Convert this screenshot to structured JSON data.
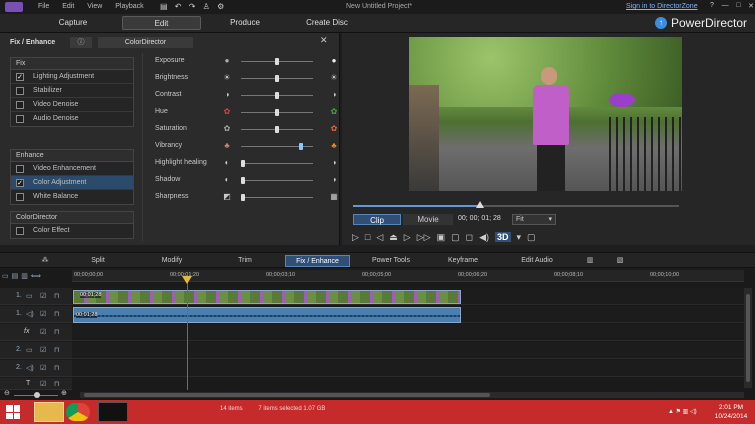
{
  "title_bar": {
    "menu": [
      "File",
      "Edit",
      "View",
      "Playback"
    ],
    "project_title": "New Untitled Project*",
    "signin_link": "Sign in to DirectorZone",
    "window_controls": [
      "?",
      "—",
      "□",
      "✕"
    ]
  },
  "modes": {
    "items": [
      "Capture",
      "Edit",
      "Produce",
      "Create Disc"
    ],
    "active": "Edit",
    "brand": "PowerDirector"
  },
  "fix_panel": {
    "title": "Fix / Enhance",
    "info_symbol": "ⓘ",
    "tab_label": "ColorDirector",
    "close_symbol": "✕",
    "groups": [
      {
        "header": "Fix",
        "items": [
          {
            "label": "Lighting Adjustment",
            "checked": true,
            "selected": false
          },
          {
            "label": "Stabilizer",
            "checked": false,
            "selected": false
          },
          {
            "label": "Video Denoise",
            "checked": false,
            "selected": false
          },
          {
            "label": "Audio Denoise",
            "checked": false,
            "selected": false
          }
        ]
      },
      {
        "header": "Enhance",
        "items": [
          {
            "label": "Video Enhancement",
            "checked": false,
            "selected": false
          },
          {
            "label": "Color Adjustment",
            "checked": true,
            "selected": true
          },
          {
            "label": "White Balance",
            "checked": false,
            "selected": false
          }
        ]
      },
      {
        "header": "ColorDirector",
        "items": [
          {
            "label": "Color Effect",
            "checked": false,
            "selected": false
          }
        ]
      }
    ],
    "sliders": [
      {
        "label": "Exposure",
        "value": 0.5
      },
      {
        "label": "Brightness",
        "value": 0.5
      },
      {
        "label": "Contrast",
        "value": 0.5
      },
      {
        "label": "Hue",
        "value": 0.5
      },
      {
        "label": "Saturation",
        "value": 0.5
      },
      {
        "label": "Vibrancy",
        "value": 0.85
      },
      {
        "label": "Highlight healing",
        "value": 0.0
      },
      {
        "label": "Shadow",
        "value": 0.0
      },
      {
        "label": "Sharpness",
        "value": 0.0
      }
    ]
  },
  "preview": {
    "progress": 0.39,
    "tab_clip": "Clip",
    "tab_movie": "Movie",
    "timecode": "00; 00; 01; 28",
    "fit_label": "Fit",
    "controls": [
      "▷",
      "□",
      "◁",
      "⏏",
      "▷",
      "▷▷",
      "▣",
      "▢",
      "◻",
      "◀)",
      "3D",
      "▾",
      "▢"
    ]
  },
  "toolbar": {
    "items": [
      "Split",
      "Modify",
      "Trim",
      "Fix / Enhance",
      "Power Tools",
      "Keyframe",
      "Edit Audio"
    ],
    "active": "Fix / Enhance"
  },
  "timeline": {
    "ruler_ticks": [
      "00;00;00;00",
      "00;00;01;20",
      "00;00;03;10",
      "00;00;05;00",
      "00;00;06;20",
      "00;00;08;10",
      "00;00;10;00"
    ],
    "tracks": [
      "1.",
      "1.",
      "fx",
      "2.",
      "2.",
      "T"
    ],
    "video_clip_label": "00;01;28",
    "audio_clip_label": "00;01;28"
  },
  "status_bar": {
    "items_count": "14 items",
    "selected": "7 items selected  1.07 GB"
  },
  "system_tray": {
    "time": "2:01 PM",
    "date": "10/24/2014"
  },
  "colors": {
    "accent": "#2f4f77",
    "taskbar": "#c52b2b",
    "clip": "#4b7fb0"
  }
}
